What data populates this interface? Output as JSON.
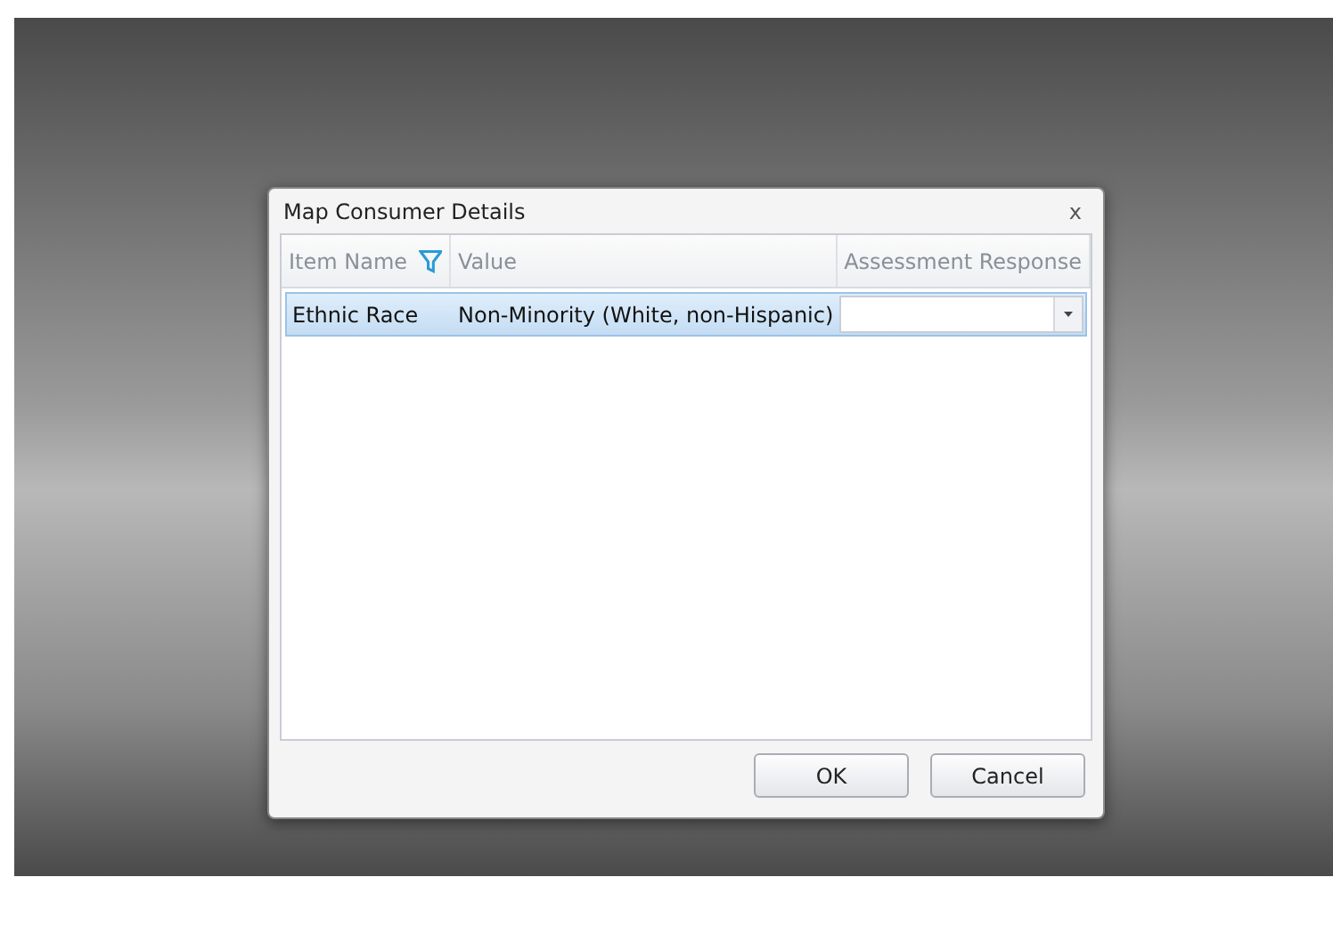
{
  "dialog": {
    "title": "Map Consumer Details",
    "close": "x"
  },
  "table": {
    "columns": [
      {
        "label": "Item Name",
        "filter": true
      },
      {
        "label": "Value",
        "filter": false
      },
      {
        "label": "Assessment Response",
        "filter": false
      }
    ],
    "rows": [
      {
        "item_name": "Ethnic Race",
        "value": "Non-Minority (White, non-Hispanic)",
        "selected": true
      }
    ]
  },
  "buttons": [
    "OK",
    "Cancel"
  ]
}
